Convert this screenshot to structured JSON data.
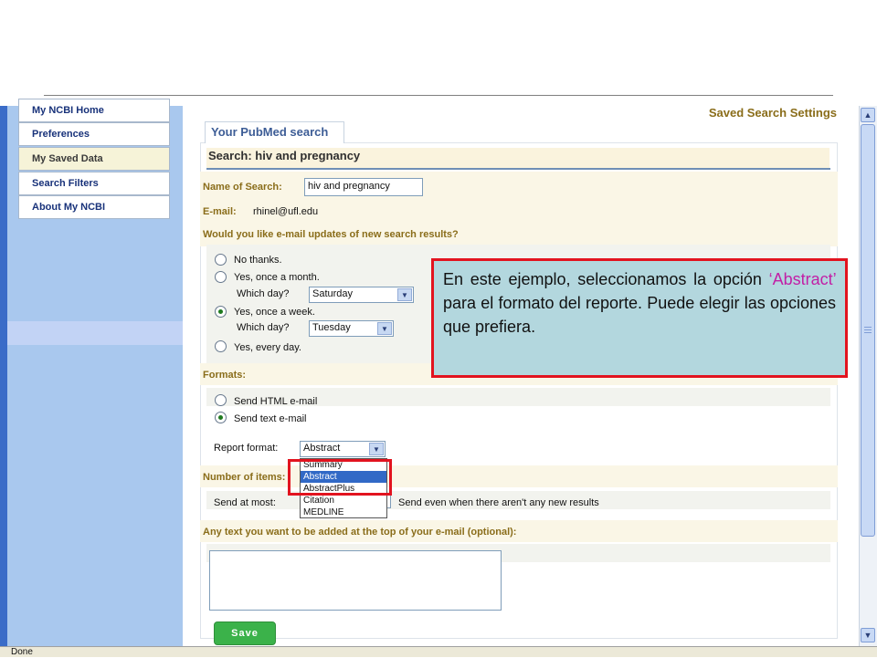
{
  "sidebar": {
    "items": [
      {
        "label": "My NCBI Home"
      },
      {
        "label": "Preferences"
      },
      {
        "label": "My Saved Data"
      },
      {
        "label": "Search Filters"
      },
      {
        "label": "About My NCBI"
      }
    ]
  },
  "header": {
    "title": "Saved Search Settings",
    "tab_label": "Your PubMed search"
  },
  "search": {
    "heading": "Search: hiv and pregnancy",
    "name_label": "Name of Search:",
    "name_value": "hiv and pregnancy",
    "email_label": "E-mail:",
    "email_value": "rhinel@ufl.edu"
  },
  "updates": {
    "question": "Would you like e-mail updates of new search results?",
    "options": [
      {
        "label": "No thanks."
      },
      {
        "label": "Yes, once a month."
      },
      {
        "label": "Yes, once a week."
      },
      {
        "label": "Yes, every day."
      }
    ],
    "which_day_label": "Which day?",
    "monthly_day": "Saturday",
    "weekly_day": "Tuesday"
  },
  "formats": {
    "label": "Formats:",
    "options": [
      {
        "label": "Send HTML e-mail"
      },
      {
        "label": "Send text e-mail"
      }
    ],
    "report_format_label": "Report format:",
    "report_format_value": "Abstract",
    "report_options": [
      "Summary",
      "Abstract",
      "AbstractPlus",
      "Citation",
      "MEDLINE"
    ]
  },
  "items": {
    "label": "Number of items:",
    "send_at_most_label": "Send at most:",
    "send_even_label": "Send even when there aren't any new results"
  },
  "extra_text": {
    "label": "Any text you want to be added at the top of your e-mail (optional):"
  },
  "save_button": "Save",
  "callout": {
    "part1": "En este ejemplo, seleccionamos la opción ",
    "emphasis": "‘Abstract’",
    "part2": " para el formato del reporte. Puede elegir las opciones que prefiera."
  },
  "status_text": "Done"
}
